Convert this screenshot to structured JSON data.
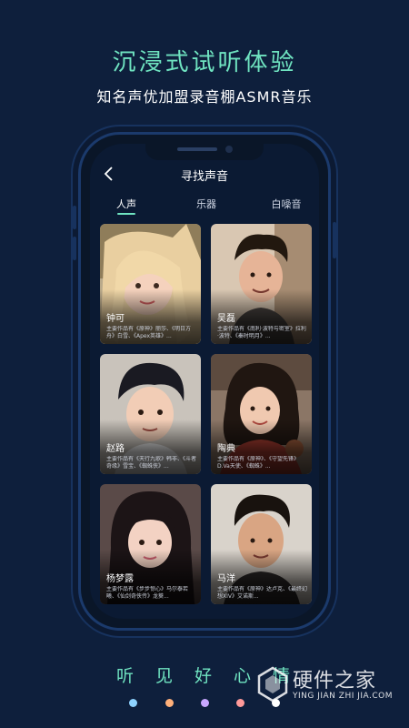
{
  "promo": {
    "headline": "沉浸式试听体验",
    "subline": "知名声优加盟录音棚ASMR音乐"
  },
  "app": {
    "title": "寻找声音",
    "back_icon": "chevron-left-icon",
    "accent_color": "#6fe3c0",
    "tabs": [
      {
        "label": "人声",
        "active": true
      },
      {
        "label": "乐器",
        "active": false
      },
      {
        "label": "白噪音",
        "active": false
      }
    ]
  },
  "voices": [
    {
      "name": "钟可",
      "desc": "主要作品有《原神》丽莎、《明日方舟》白雪、《Apex英雄》..."
    },
    {
      "name": "吴磊",
      "desc": "主要作品有《南利·波特与密室》拉利·波特、《秦时明月》..."
    },
    {
      "name": "赵路",
      "desc": "主要作品有《天行九歌》韩非、《斗者奇缘》雪宝、《蜘蛛侠》..."
    },
    {
      "name": "陶典",
      "desc": "主要作品有《原神》、《守望先锋》D.Va天使、《蜘蛛》..."
    },
    {
      "name": "杨梦露",
      "desc": "主要作品有《步步惊心》马尔泰若曦、《仙剑奇侠传》龙葵..."
    },
    {
      "name": "马洋",
      "desc": "主要作品有《原神》达卢克、《最终幻想XIV》艾诺斯..."
    }
  ],
  "bottom": {
    "words": [
      "听",
      "见",
      "好",
      "心",
      "情"
    ],
    "dot_colors": [
      "#8fd3ff",
      "#ffb07a",
      "#c8a8ff",
      "#ff9a9a",
      "#ffffff"
    ]
  },
  "watermark": {
    "text": "硬件之家",
    "sub": "YING JIAN ZHI JIA.COM"
  }
}
